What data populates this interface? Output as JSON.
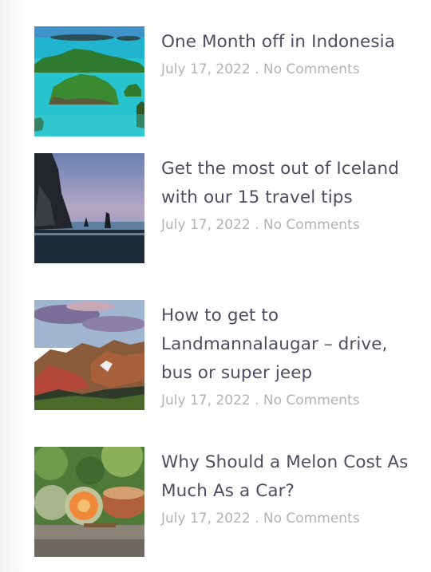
{
  "posts": [
    {
      "title": "One Month off in Indonesia",
      "date": "July 17, 2022",
      "separator": " . ",
      "comments": "No Comments",
      "image_icon": "tropical-islands-image"
    },
    {
      "title": "Get the most out of Iceland with our 15 travel tips",
      "date": "July 17, 2022",
      "separator": " . ",
      "comments": "No Comments",
      "image_icon": "black-sand-beach-image"
    },
    {
      "title": "How to get to Landmannalaugar – drive, bus or super jeep",
      "date": "July 17, 2022",
      "separator": " . ",
      "comments": "No Comments",
      "image_icon": "colorful-mountains-image"
    },
    {
      "title": "Why Should a Melon Cost As Much As a Car?",
      "date": "July 17, 2022",
      "separator": " . ",
      "comments": "No Comments",
      "image_icon": "melons-image"
    }
  ]
}
